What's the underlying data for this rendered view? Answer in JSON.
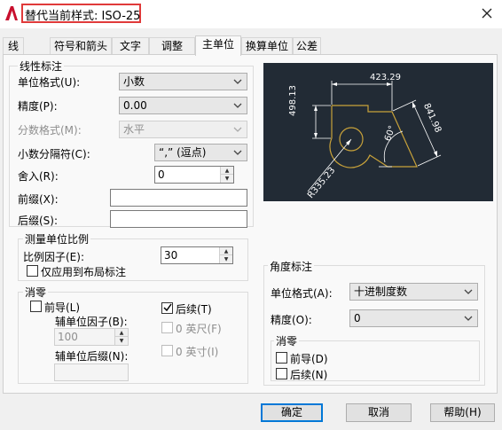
{
  "window": {
    "title": "替代当前样式: ISO-25",
    "logo_icon": "autocad-a-logo",
    "close_icon": "close-x-icon"
  },
  "tabs": [
    {
      "label": "线"
    },
    {
      "label": "符号和箭头"
    },
    {
      "label": "文字"
    },
    {
      "label": "调整"
    },
    {
      "label": "主单位",
      "active": true
    },
    {
      "label": "换算单位"
    },
    {
      "label": "公差"
    }
  ],
  "linear": {
    "group_title": "线性标注",
    "unit_format_label": "单位格式(U):",
    "unit_format_value": "小数",
    "precision_label": "精度(P):",
    "precision_value": "0.00",
    "fraction_format_label": "分数格式(M):",
    "fraction_format_value": "水平",
    "decimal_sep_label": "小数分隔符(C):",
    "decimal_sep_value": "“,” (逗点)",
    "round_label": "舍入(R):",
    "round_value": "0",
    "prefix_label": "前缀(X):",
    "prefix_value": "",
    "suffix_label": "后缀(S):",
    "suffix_value": ""
  },
  "scale": {
    "group_title": "测量单位比例",
    "factor_label": "比例因子(E):",
    "factor_value": "30",
    "layout_only_label": "仅应用到布局标注",
    "layout_only_checked": false
  },
  "zero_suppression": {
    "group_title": "消零",
    "leading_label": "前导(L)",
    "leading_checked": false,
    "trailing_label": "后续(T)",
    "trailing_checked": true,
    "sub_factor_label": "辅单位因子(B):",
    "sub_factor_value": "100",
    "sub_suffix_label": "辅单位后缀(N):",
    "sub_suffix_value": "",
    "feet_label": "0 英尺(F)",
    "inches_label": "0 英寸(I)"
  },
  "preview": {
    "dim_top": "423.29",
    "dim_left": "498.13",
    "dim_right": "841.98",
    "dim_radius": "R335.23",
    "dim_angle": "60°",
    "bg_color": "#222b35",
    "line_color": "#c8a23a",
    "dim_color": "#ffffff"
  },
  "angular": {
    "group_title": "角度标注",
    "unit_format_label": "单位格式(A):",
    "unit_format_value": "十进制度数",
    "precision_label": "精度(O):",
    "precision_value": "0",
    "zero_title": "消零",
    "leading_label": "前导(D)",
    "leading_checked": false,
    "trailing_label": "后续(N)",
    "trailing_checked": false
  },
  "buttons": {
    "ok": "确定",
    "cancel": "取消",
    "help": "帮助(H)"
  }
}
